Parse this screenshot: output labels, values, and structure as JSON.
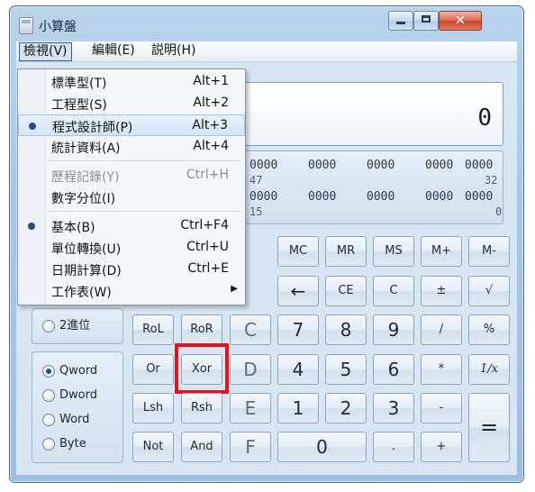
{
  "window": {
    "title": "小算盤"
  },
  "menubar": {
    "view": "檢視(V)",
    "edit": "編輯(E)",
    "help": "説明(H)"
  },
  "display": {
    "value": "0"
  },
  "bits": {
    "row1": [
      "0000",
      "0000",
      "0000",
      "0000",
      "0000"
    ],
    "row1_positions": [
      "47",
      "32"
    ],
    "row2": [
      "0000",
      "0000",
      "0000",
      "0000",
      "0000"
    ],
    "row2_positions": [
      "15",
      "0"
    ]
  },
  "base_group": {
    "bin": "2進位"
  },
  "word_group": {
    "items": [
      {
        "label": "Qword",
        "checked": true
      },
      {
        "label": "Dword",
        "checked": false
      },
      {
        "label": "Word",
        "checked": false
      },
      {
        "label": "Byte",
        "checked": false
      }
    ]
  },
  "keys": {
    "mc": "MC",
    "mr": "MR",
    "ms": "MS",
    "mplus": "M+",
    "mminus": "M-",
    "back": "←",
    "ce": "CE",
    "c": "C",
    "pm": "±",
    "sqrt": "√",
    "rol": "RoL",
    "ror": "RoR",
    "hexc": "C",
    "seven": "7",
    "eight": "8",
    "nine": "9",
    "div": "/",
    "pct": "%",
    "or": "Or",
    "xor": "Xor",
    "hexd": "D",
    "four": "4",
    "five": "5",
    "six": "6",
    "mul": "*",
    "recip": "1/x",
    "lsh": "Lsh",
    "rsh": "Rsh",
    "hexe": "E",
    "one": "1",
    "two": "2",
    "three": "3",
    "minus": "-",
    "eq": "=",
    "not": "Not",
    "and": "And",
    "hexf": "F",
    "zero": "0",
    "dot": ".",
    "plus": "+"
  },
  "view_menu": {
    "items": [
      {
        "label": "標準型(T)",
        "shortcut": "Alt+1"
      },
      {
        "label": "工程型(S)",
        "shortcut": "Alt+2"
      },
      {
        "label": "程式設計師(P)",
        "shortcut": "Alt+3"
      },
      {
        "label": "統計資料(A)",
        "shortcut": "Alt+4"
      },
      {
        "label": "歷程記錄(Y)",
        "shortcut": "Ctrl+H"
      },
      {
        "label": "數字分位(I)",
        "shortcut": ""
      },
      {
        "label": "基本(B)",
        "shortcut": "Ctrl+F4"
      },
      {
        "label": "單位轉換(U)",
        "shortcut": "Ctrl+U"
      },
      {
        "label": "日期計算(D)",
        "shortcut": "Ctrl+E"
      },
      {
        "label": "工作表(W)",
        "shortcut": ""
      }
    ]
  },
  "colors": {
    "highlight": "#e0141b",
    "accent": "#1d4f8a"
  }
}
